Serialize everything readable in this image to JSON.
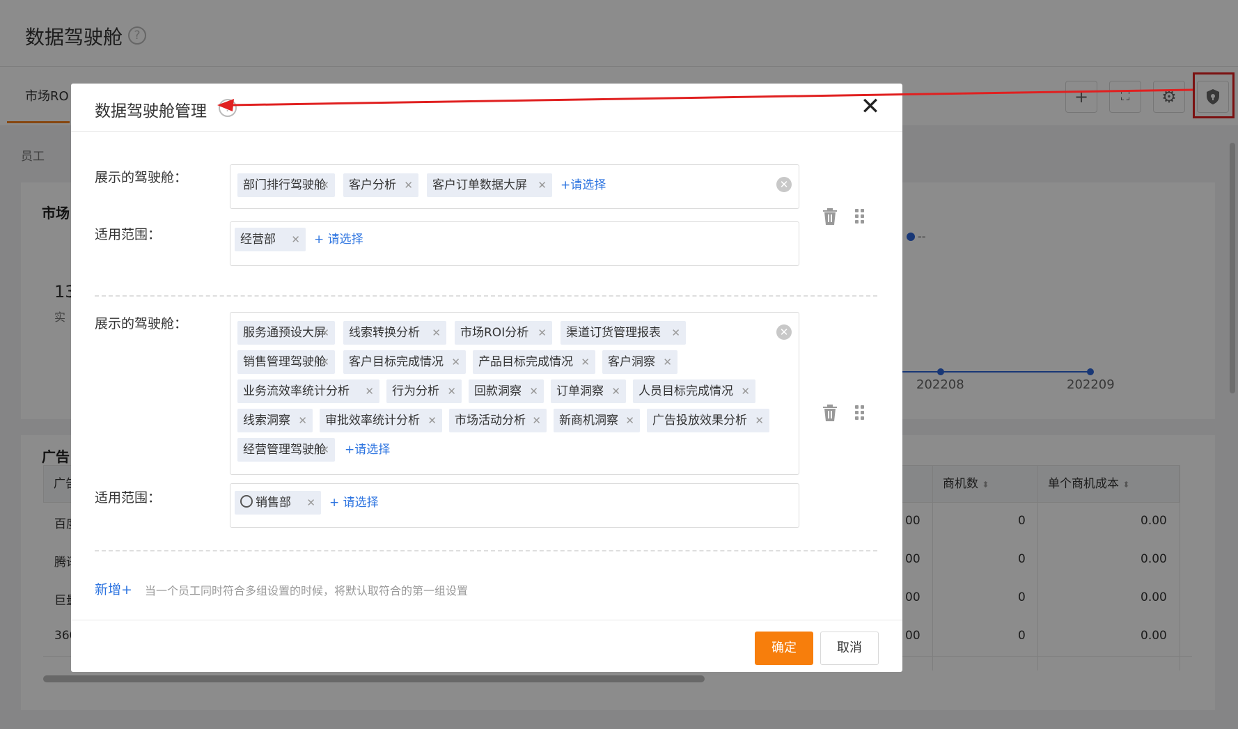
{
  "page": {
    "title": "数据驾驶舱",
    "tab": "市场RO",
    "filter_label": "员工",
    "panel_title": "市场",
    "big_value": "13",
    "big_caption": "实",
    "legend_text": "--",
    "x_ticks": [
      "202208",
      "202209"
    ],
    "table_title": "广告",
    "table_headers": [
      "广告",
      "商机数",
      "单个商机成本"
    ],
    "table_rows": [
      {
        "name": "百度",
        "a": "00",
        "b": "0",
        "c": "0.00"
      },
      {
        "name": "腾讯",
        "a": "00",
        "b": "0",
        "c": "0.00"
      },
      {
        "name": "巨量",
        "a": "00",
        "b": "0",
        "c": "0.00"
      },
      {
        "name": "360",
        "a": "00",
        "b": "0",
        "c": "0.00"
      }
    ],
    "toolbar_icons": [
      "plus-icon",
      "fullscreen-icon",
      "gear-icon",
      "shield-icon"
    ]
  },
  "dialog": {
    "title": "数据驾驶舱管理",
    "close_icon": "close-icon",
    "groups": [
      {
        "cockpit_label": "展示的驾驶舱：",
        "cockpits": [
          "部门排行驾驶舱",
          "客户分析",
          "客户订单数据大屏"
        ],
        "cockpit_add": "+请选择",
        "scope_label": "适用范围：",
        "scopes": [
          "经营部"
        ],
        "scope_add": "+ 请选择"
      },
      {
        "cockpit_label": "展示的驾驶舱：",
        "cockpits": [
          "服务通预设大屏",
          "线索转换分析",
          "市场ROI分析",
          "渠道订货管理报表",
          "销售管理驾驶舱",
          "客户目标完成情况",
          "产品目标完成情况",
          "客户洞察",
          "业务流效率统计分析",
          "行为分析",
          "回款洞察",
          "订单洞察",
          "人员目标完成情况",
          "线索洞察",
          "审批效率统计分析",
          "市场活动分析",
          "新商机洞察",
          "广告投放效果分析",
          "经营管理驾驶舱"
        ],
        "cockpit_add": "+请选择",
        "scope_label": "适用范围：",
        "scopes": [
          "销售部"
        ],
        "scope_add": "+ 请选择"
      }
    ],
    "add_group": "新增+",
    "hint": "当一个员工同时符合多组设置的时候，将默认取符合的第一组设置",
    "ok": "确定",
    "cancel": "取消"
  },
  "colors": {
    "accent": "#f77e0c",
    "link": "#2d74e0",
    "highlight": "#e02020",
    "tag_bg": "#e9edf5"
  }
}
